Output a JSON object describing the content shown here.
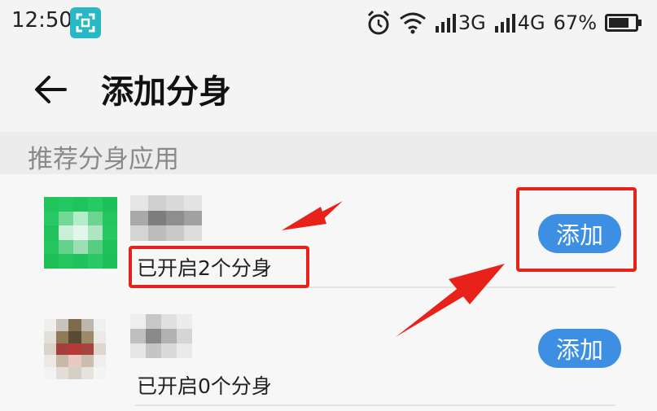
{
  "status_bar": {
    "time": "12:50",
    "network_3g": "3G",
    "network_4g": "4G",
    "battery": "67%"
  },
  "header": {
    "title": "添加分身"
  },
  "section": {
    "label": "推荐分身应用"
  },
  "apps": [
    {
      "status": "已开启2个分身",
      "button_label": "添加"
    },
    {
      "status": "已开启0个分身",
      "button_label": "添加"
    }
  ],
  "colors": {
    "accent": "#3d8fe3",
    "annotation_red": "#e8221b",
    "scan_icon": "#26b8c4"
  }
}
